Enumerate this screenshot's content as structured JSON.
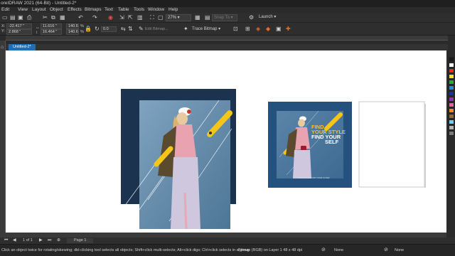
{
  "app": {
    "title": "oreIDRAW 2021 (64-Bit) - Untitled-2*"
  },
  "menu": [
    "Edit",
    "View",
    "Layout",
    "Object",
    "Effects",
    "Bitmaps",
    "Text",
    "Table",
    "Tools",
    "Window",
    "Help"
  ],
  "toolbar1": {
    "zoom": "27%",
    "snap_to": "Snap To",
    "launch": "Launch"
  },
  "property_bar": {
    "x": "-22.417 \"",
    "y": "2.868 \"",
    "w": "11.616 \"",
    "h": "16.464 \"",
    "scale_w": "140.6",
    "scale_h": "140.6",
    "pct": "%",
    "angle": "0.0",
    "edit_bitmap": "Edit Bitmap...",
    "trace_bitmap": "Trace Bitmap"
  },
  "tabs": [
    {
      "label": "Untitled-2*"
    }
  ],
  "poster": {
    "line1": "FIND",
    "line2": "YOUR STYLE",
    "line3": "FIND YOUR",
    "line4": "SELF",
    "small": "INFO LOGO FOR YOUR FLYER"
  },
  "pagebar": {
    "page_counter": "1 of 1",
    "page_tab": "Page 1"
  },
  "status": {
    "hint": "Click an object twice for rotating/skewing; dbl-clicking tool selects all objects; Shift+click multi-selects; Alt+click digs; Ctrl+click selects in a group",
    "object_info": "Bitmap (RGB) on Layer 1 48 x 48 dpi",
    "fill": "None",
    "outline": "None"
  },
  "colors": {
    "accent": "#1e6fb8",
    "poster_bg": "#1c3350",
    "poster_small_bg": "#25517e",
    "yellow": "#f5c518"
  },
  "palette": [
    "#1a1a1a",
    "#ffffff",
    "#e62b2b",
    "#f0e12a",
    "#2ea64a",
    "#2b8ad6",
    "#1c2f9e",
    "#9a2fb0",
    "#e0669a",
    "#f08a1f",
    "#8c6a3c",
    "#6fd0e8",
    "#b3b3b3",
    "#7a7a7a"
  ]
}
